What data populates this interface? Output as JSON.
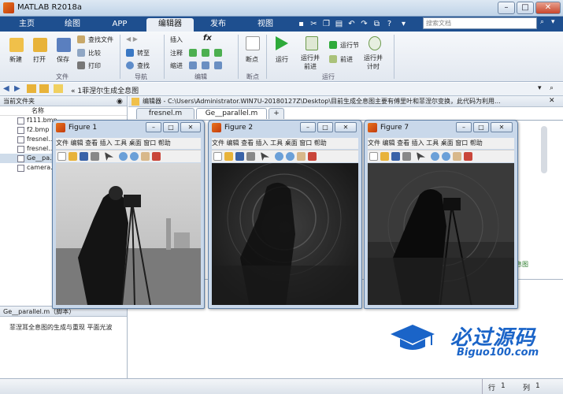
{
  "window": {
    "title": "MATLAB R2018a",
    "btn_min": "–",
    "btn_max": "□",
    "btn_close": "✕"
  },
  "tabs": [
    "主页",
    "绘图",
    "APP",
    "编辑器",
    "发布",
    "视图"
  ],
  "search": {
    "placeholder": "搜索文档"
  },
  "ribbon": {
    "new_label": "新建",
    "open_label": "打开",
    "save_label": "保存",
    "find_files": "查找文件",
    "compare": "比较",
    "print": "打印",
    "goto": "转至",
    "find": "查找",
    "insert": "插入",
    "comment": "注释",
    "indent": "缩进",
    "fx": "fx",
    "breakpoints": "断点",
    "run": "运行",
    "run_advance": "运行并\n前进",
    "run_section": "运行节",
    "advance": "前进",
    "run_time": "运行并\n计时",
    "groups": {
      "file": "文件",
      "navigate": "导航",
      "edit": "编辑",
      "breakpoints": "断点",
      "run": "运行"
    }
  },
  "address": {
    "path": "« 1菲涅尔生成全息图"
  },
  "left": {
    "title": "当前文件夹",
    "col": "名称",
    "files": [
      "f111.bmp",
      "f2.bmp",
      "fresnel...",
      "fresnel...",
      "Ge__pa...",
      "camera..."
    ],
    "details_title": "Ge__parallel.m（脚本）",
    "details_text": "菲涅耳全息图的生成与重现 平面光波"
  },
  "editor": {
    "header": "编辑器 - C:\\Users\\Administrator.WIN7U-20180127Z\\Desktop\\目前生成全息图主要有傅里叶和菲涅尔变换，此代码为利用...",
    "tabs": [
      "fresnel.m",
      "Ge__parallel.m",
      "+"
    ],
    "side_text": "全息图"
  },
  "figures": [
    {
      "name": "Figure 1",
      "menu": "文件 编辑 查看 插入 工具 桌面 窗口 帮助"
    },
    {
      "name": "Figure 2",
      "menu": "文件 编辑 查看 插入 工具 桌面 窗口 帮助"
    },
    {
      "name": "Figure 7",
      "menu": "文件 编辑 查看 插入 工具 桌面 窗口 帮助"
    }
  ],
  "status": {
    "row_label": "行",
    "row": "1",
    "col_label": "列",
    "col": "1"
  },
  "watermark": {
    "main": "必过源码",
    "sub": "Biguo100.com"
  }
}
